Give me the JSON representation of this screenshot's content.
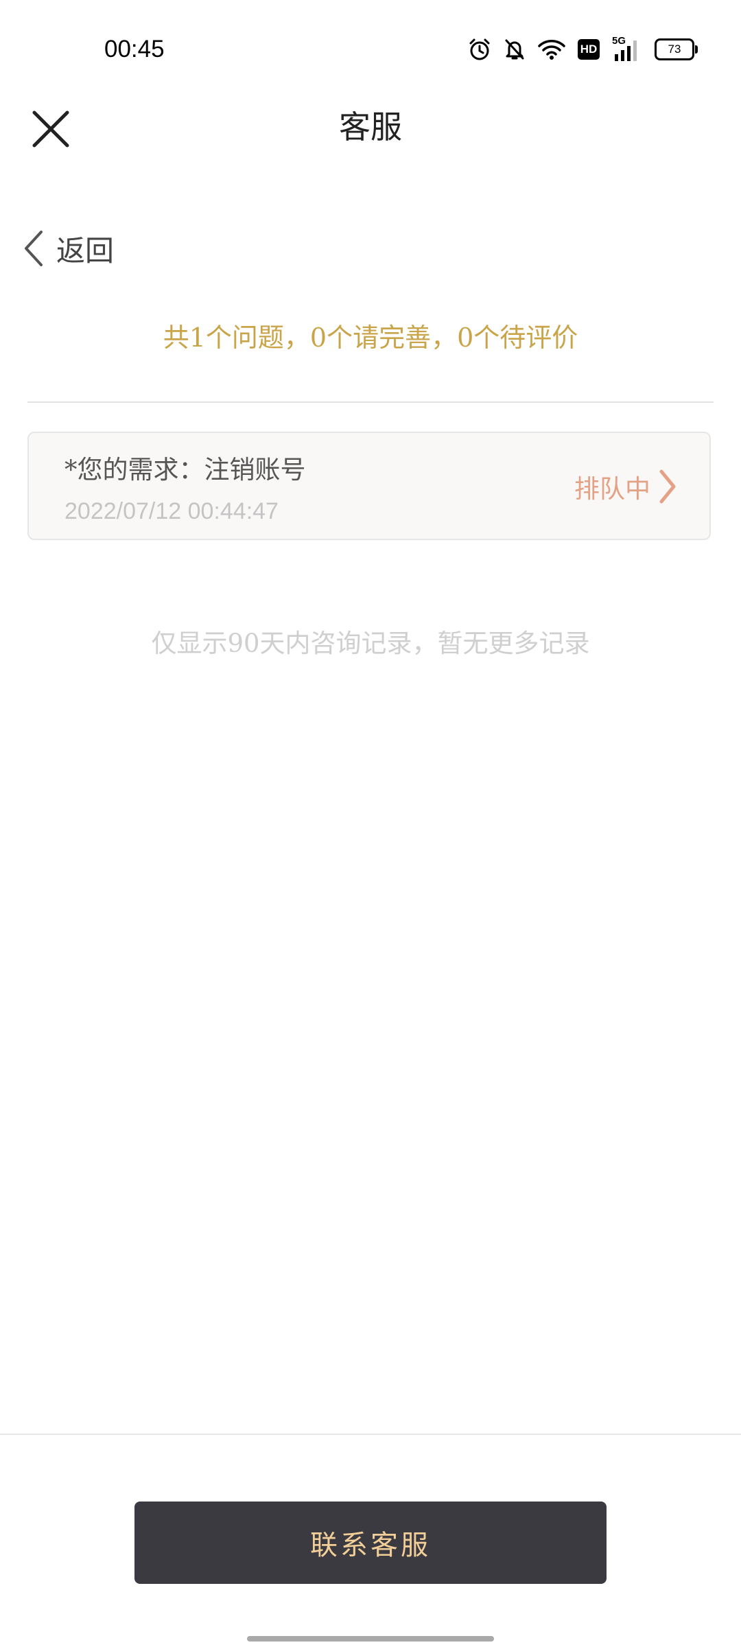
{
  "status_bar": {
    "time": "00:45",
    "icons": [
      "alarm-icon",
      "mute-bell-icon",
      "wifi-icon",
      "hd-icon",
      "5g-signal-icon",
      "battery-icon"
    ],
    "hd_label": "HD",
    "network_label": "5G",
    "battery_level": "73"
  },
  "header": {
    "title": "客服",
    "close_icon": "close-icon"
  },
  "back": {
    "label": "返回",
    "icon": "chevron-left-icon"
  },
  "summary": {
    "text": "共1个问题，0个请完善，0个待评价"
  },
  "tickets": [
    {
      "request": "*您的需求：注销账号",
      "time": "2022/07/12 00:44:47",
      "status": "排队中",
      "status_icon": "chevron-right-icon"
    }
  ],
  "notice": {
    "text": "仅显示90天内咨询记录，暂无更多记录"
  },
  "footer": {
    "contact_label": "联系客服"
  },
  "colors": {
    "summary": "#c9a449",
    "status": "#e3a285",
    "button_bg": "#3a3a40",
    "button_text": "#f2cf99"
  }
}
